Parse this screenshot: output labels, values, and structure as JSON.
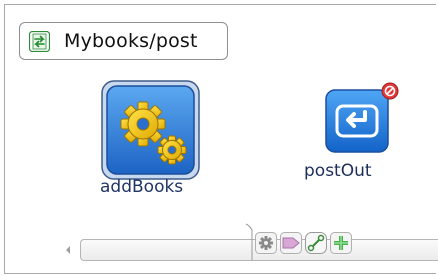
{
  "route": {
    "label": "Mybooks/post",
    "icon": "route-switch-icon"
  },
  "nodes": [
    {
      "label": "addBooks",
      "icon": "gears-icon",
      "selected": true
    },
    {
      "label": "postOut",
      "icon": "return-arrow-icon",
      "error_badge": "error-badge-icon"
    }
  ],
  "palette": {
    "items": [
      "gear-icon",
      "tag-icon",
      "connector-icon",
      "add-icon"
    ]
  },
  "colors": {
    "accent_blue": "#2a7ad6",
    "gear_yellow": "#f0c400",
    "error_red": "#e03a3a",
    "node_label": "#1f3566"
  }
}
